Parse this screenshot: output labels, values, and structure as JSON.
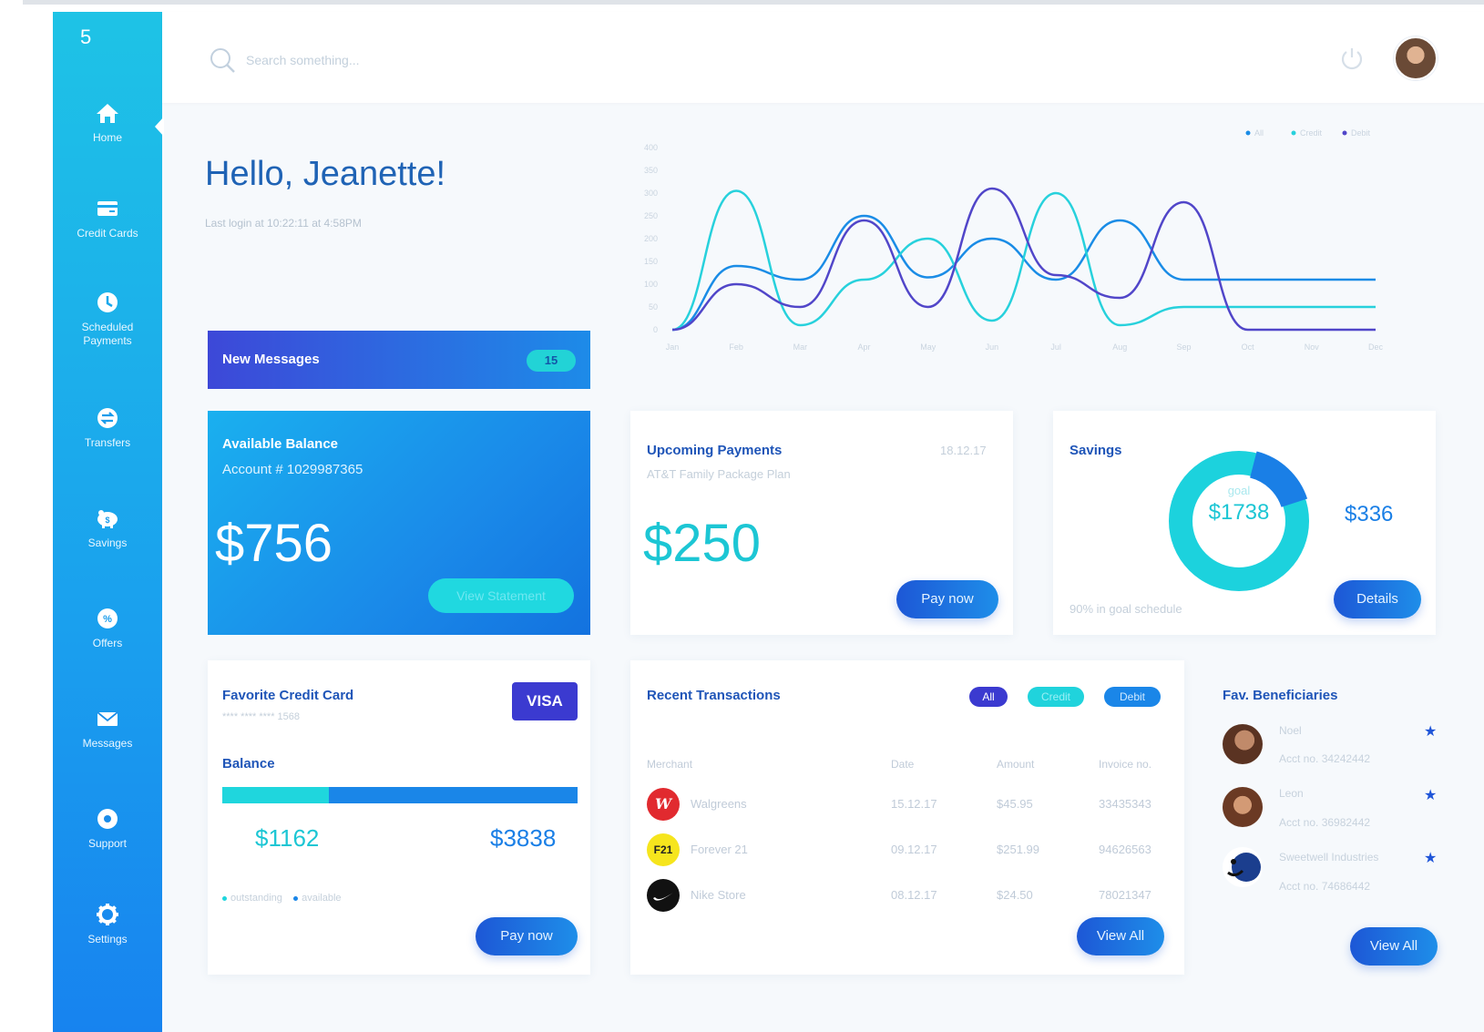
{
  "step": "5",
  "sidebar": {
    "items": [
      {
        "label": "Home"
      },
      {
        "label": "Credit Cards"
      },
      {
        "label": "Scheduled Payments"
      },
      {
        "label": "Transfers"
      },
      {
        "label": "Savings"
      },
      {
        "label": "Offers"
      },
      {
        "label": "Messages"
      },
      {
        "label": "Support"
      },
      {
        "label": "Settings"
      }
    ]
  },
  "header": {
    "search_placeholder": "Search something..."
  },
  "greeting": {
    "title": "Hello, Jeanette!",
    "last_login": "Last login at 10:22:11 at 4:58PM"
  },
  "messages": {
    "label": "New Messages",
    "count": "15"
  },
  "balance": {
    "title": "Available Balance",
    "account": "Account # 1029987365",
    "amount": "$756",
    "statement_button": "View Statement"
  },
  "chart_data": {
    "type": "line",
    "legend": [
      "All",
      "Credit",
      "Debit"
    ],
    "legend_position": "top-right",
    "x": [
      "Jan",
      "Feb",
      "Mar",
      "Apr",
      "May",
      "Jun",
      "Jul",
      "Aug",
      "Sep",
      "Oct",
      "Nov",
      "Dec"
    ],
    "y_ticks": [
      "0",
      "50",
      "100",
      "150",
      "200",
      "250",
      "300",
      "350",
      "400"
    ],
    "ylim": [
      0,
      400
    ],
    "series": [
      {
        "name": "All",
        "color": "#1a8ce6",
        "values": [
          0,
          140,
          110,
          250,
          115,
          200,
          110,
          240,
          110,
          110,
          110,
          110
        ]
      },
      {
        "name": "Credit",
        "color": "#27d1dc",
        "values": [
          0,
          305,
          10,
          110,
          200,
          20,
          300,
          10,
          50,
          50,
          50,
          50
        ]
      },
      {
        "name": "Debit",
        "color": "#5146c9",
        "values": [
          0,
          100,
          50,
          240,
          50,
          310,
          120,
          70,
          280,
          0,
          0,
          0
        ]
      }
    ]
  },
  "upcoming": {
    "title": "Upcoming Payments",
    "subtitle": "AT&T Family Package Plan",
    "date": "18.12.17",
    "amount": "$250",
    "pay_button": "Pay now"
  },
  "savings": {
    "title": "Savings",
    "goal_label": "goal",
    "goal_amount": "$1738",
    "saved_amount": "$336",
    "saved_fraction": 0.16,
    "note": "90% in goal schedule",
    "details_button": "Details"
  },
  "credit_card": {
    "title": "Favorite Credit Card",
    "number": "**** **** **** 1568",
    "brand": "VISA",
    "balance_title": "Balance",
    "outstanding": "$1162",
    "available": "$3838",
    "outstanding_fraction": 0.3,
    "legend_outstanding": "outstanding",
    "legend_available": "available",
    "pay_button": "Pay now"
  },
  "transactions": {
    "title": "Recent Transactions",
    "filters": [
      "All",
      "Credit",
      "Debit"
    ],
    "columns": [
      "Merchant",
      "Date",
      "Amount",
      "Invoice no."
    ],
    "rows": [
      {
        "merchant": "Walgreens",
        "date": "15.12.17",
        "amount": "$45.95",
        "invoice": "33435343"
      },
      {
        "merchant": "Forever 21",
        "date": "09.12.17",
        "amount": "$251.99",
        "invoice": "94626563"
      },
      {
        "merchant": "Nike Store",
        "date": "08.12.17",
        "amount": "$24.50",
        "invoice": "78021347"
      }
    ],
    "view_all": "View All"
  },
  "beneficiaries": {
    "title": "Fav. Beneficiaries",
    "items": [
      {
        "name": "Noel",
        "account": "Acct no. 34242442"
      },
      {
        "name": "Leon",
        "account": "Acct no. 36982442"
      },
      {
        "name": "Sweetwell Industries",
        "account": "Acct no. 74686442"
      }
    ],
    "view_all": "View All"
  },
  "colors": {
    "sidebar_top": "#1ec3e6",
    "sidebar_bottom": "#1783ef",
    "accent_blue": "#1f55b8",
    "teal": "#1cc6d4",
    "indigo": "#3d48d8"
  }
}
